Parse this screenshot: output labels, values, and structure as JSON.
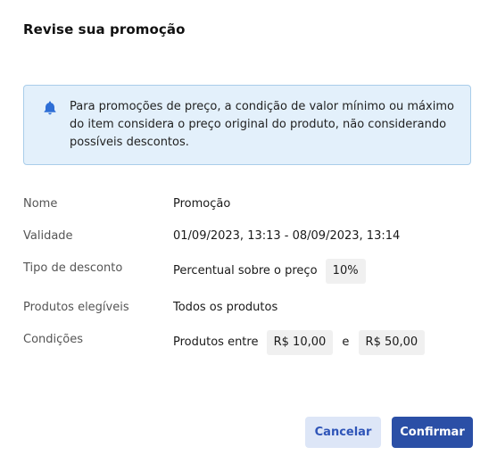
{
  "dialog": {
    "title": "Revise sua promoção",
    "alert": {
      "icon": "bell-icon",
      "text": "Para promoções de preço, a condição de valor mínimo ou máximo do item considera o preço original do produto, não considerando possíveis descontos."
    },
    "details": {
      "nome": {
        "label": "Nome",
        "value": "Promoção"
      },
      "validade": {
        "label": "Validade",
        "value": "01/09/2023, 13:13 - 08/09/2023, 13:14"
      },
      "tipo_desconto": {
        "label": "Tipo de desconto",
        "value": "Percentual sobre o preço",
        "chip": "10%"
      },
      "produtos": {
        "label": "Produtos elegíveis",
        "value": "Todos os produtos"
      },
      "condicoes": {
        "label": "Condições",
        "prefix": "Produtos entre",
        "min": "R$ 10,00",
        "connector": "e",
        "max": "R$ 50,00"
      }
    },
    "buttons": {
      "cancel": "Cancelar",
      "confirm": "Confirmar"
    }
  },
  "colors": {
    "alert_bg": "#e3f0fb",
    "alert_border": "#a9cdea",
    "icon_blue": "#2f6fd6",
    "primary": "#2b4fa6",
    "secondary_bg": "#dde6f7"
  }
}
